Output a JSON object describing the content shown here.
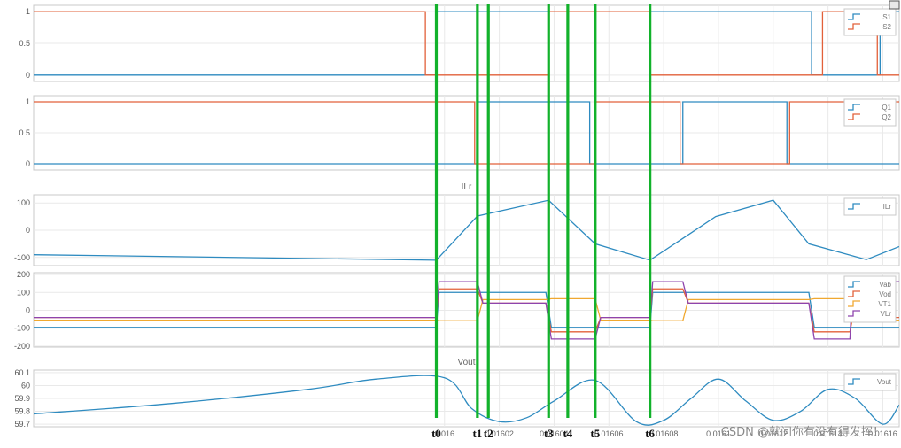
{
  "chart_data": [
    {
      "type": "line",
      "title": "",
      "ylim": [
        -0.1,
        1.1
      ],
      "yticks": [
        0,
        0.5,
        1
      ],
      "ytick_labels": [
        "0",
        "0.5",
        "1"
      ],
      "legend_location": "top-right",
      "series": [
        {
          "name": "S1",
          "color": "#2e8bc0",
          "x": [
            0.01585,
            0.015997,
            0.015997,
            0.016134,
            0.016134,
            0.016159,
            0.016159,
            0.016166
          ],
          "y": [
            0,
            0,
            1,
            1,
            0,
            0,
            1,
            1
          ]
        },
        {
          "name": "S2",
          "color": "#e2603a",
          "x": [
            0.01585,
            0.015993,
            0.015993,
            0.016038,
            0.016038,
            0.016075,
            0.016075,
            0.016138,
            0.016138,
            0.016158,
            0.016158,
            0.016166
          ],
          "y": [
            1,
            1,
            0,
            0,
            1,
            1,
            0,
            0,
            1,
            1,
            0,
            0
          ]
        }
      ]
    },
    {
      "type": "line",
      "title": "",
      "ylim": [
        -0.1,
        1.1
      ],
      "yticks": [
        0,
        0.5,
        1
      ],
      "ytick_labels": [
        "0",
        "0.5",
        "1"
      ],
      "legend_location": "top-right",
      "series": [
        {
          "name": "Q1",
          "color": "#2e8bc0",
          "x": [
            0.01585,
            0.016012,
            0.016012,
            0.016053,
            0.016053,
            0.016087,
            0.016087,
            0.016125,
            0.016125,
            0.016166
          ],
          "y": [
            0,
            0,
            1,
            1,
            0,
            0,
            1,
            1,
            0,
            0
          ]
        },
        {
          "name": "Q2",
          "color": "#e2603a",
          "x": [
            0.01585,
            0.016011,
            0.016011,
            0.016055,
            0.016055,
            0.016086,
            0.016086,
            0.016126,
            0.016126,
            0.016166
          ],
          "y": [
            1,
            1,
            0,
            0,
            1,
            1,
            0,
            0,
            1,
            1
          ]
        }
      ]
    },
    {
      "type": "line",
      "title": "ILr",
      "ylim": [
        -130,
        130
      ],
      "yticks": [
        -100,
        0,
        100
      ],
      "ytick_labels": [
        "-100",
        "0",
        "100"
      ],
      "legend_location": "top-right",
      "series": [
        {
          "name": "ILr",
          "color": "#2e8bc0",
          "x": [
            0.01585,
            0.015997,
            0.016012,
            0.016038,
            0.016055,
            0.016075,
            0.016099,
            0.01612,
            0.016133,
            0.016154,
            0.016166
          ],
          "y": [
            -90,
            -110,
            52,
            110,
            -50,
            -110,
            50,
            110,
            -50,
            -108,
            -60
          ]
        }
      ]
    },
    {
      "type": "line",
      "title": "",
      "ylim": [
        -205,
        210
      ],
      "yticks": [
        -200,
        -100,
        0,
        100,
        200
      ],
      "ytick_labels": [
        "-200",
        "-100",
        "0",
        "100",
        "200"
      ],
      "legend_location": "top-right",
      "series": [
        {
          "name": "Vab",
          "color": "#2e8bc0",
          "x": [
            0.01585,
            0.015997,
            0.015998,
            0.016037,
            0.016039,
            0.016075,
            0.016076,
            0.016133,
            0.016135,
            0.016166
          ],
          "y": [
            -95,
            -95,
            100,
            100,
            -95,
            -95,
            100,
            100,
            -95,
            -95
          ]
        },
        {
          "name": "Vod",
          "color": "#e2603a",
          "x": [
            0.01585,
            0.015997,
            0.015998,
            0.016012,
            0.016014,
            0.016037,
            0.016039,
            0.016055,
            0.016057,
            0.016075,
            0.016076,
            0.016087,
            0.016089,
            0.016133,
            0.016135,
            0.016148,
            0.016149,
            0.016166
          ],
          "y": [
            -40,
            -40,
            120,
            120,
            40,
            40,
            -120,
            -120,
            -40,
            -40,
            120,
            120,
            40,
            40,
            -120,
            -120,
            -40,
            -40
          ]
        },
        {
          "name": "VT1",
          "color": "#f0a830",
          "x": [
            0.01585,
            0.015997,
            0.015998,
            0.016012,
            0.016014,
            0.016037,
            0.016039,
            0.016055,
            0.016057,
            0.016075,
            0.016076,
            0.016087,
            0.016089,
            0.016133,
            0.016135,
            0.016148,
            0.016149,
            0.016166
          ],
          "y": [
            -55,
            -55,
            -58,
            -58,
            60,
            60,
            65,
            65,
            -55,
            -55,
            -58,
            -58,
            60,
            60,
            65,
            65,
            -55,
            -55
          ]
        },
        {
          "name": "VLr",
          "color": "#8e44ad",
          "x": [
            0.01585,
            0.015997,
            0.015998,
            0.016012,
            0.016014,
            0.016037,
            0.016039,
            0.016055,
            0.016057,
            0.016075,
            0.016076,
            0.016087,
            0.016089,
            0.016133,
            0.016135,
            0.016148,
            0.016149,
            0.016166
          ],
          "y": [
            -40,
            -40,
            160,
            160,
            40,
            40,
            -160,
            -160,
            -40,
            -40,
            160,
            160,
            40,
            40,
            -160,
            -160,
            160,
            160
          ]
        }
      ]
    },
    {
      "type": "line",
      "title": "Vout",
      "ylim": [
        59.68,
        60.12
      ],
      "yticks": [
        59.7,
        59.8,
        59.9,
        60,
        60.1
      ],
      "ytick_labels": [
        "59.7",
        "59.8",
        "59.9",
        "60",
        "60.1"
      ],
      "legend_location": "top-right",
      "xlim": [
        0.01585,
        0.016166
      ],
      "xticks": [
        0.016,
        0.01602,
        0.01604,
        0.01606,
        0.01608,
        0.0161,
        0.01612,
        0.01614,
        0.01616
      ],
      "xtick_labels": [
        "0.016",
        "0.01602",
        "0.01604",
        "0.01606",
        "0.01608",
        "0.0161",
        "0.01612",
        "0.01614",
        "0.01616"
      ],
      "series": [
        {
          "name": "Vout",
          "color": "#2e8bc0",
          "x": [
            0.01585,
            0.0159,
            0.01595,
            0.015975,
            0.016,
            0.01601,
            0.01602,
            0.01603,
            0.01604,
            0.016055,
            0.01607,
            0.01608,
            0.01609,
            0.0161,
            0.01611,
            0.01612,
            0.01613,
            0.01614,
            0.01615,
            0.01616,
            0.016166
          ],
          "y": [
            59.78,
            59.86,
            59.97,
            60.05,
            60.06,
            59.82,
            59.72,
            59.75,
            59.88,
            60.04,
            59.72,
            59.73,
            59.9,
            60.05,
            59.88,
            59.73,
            59.8,
            59.97,
            59.9,
            59.7,
            59.85
          ]
        }
      ]
    }
  ],
  "markers": [
    {
      "label": "t0",
      "x": 0.015997
    },
    {
      "label": "t1",
      "x": 0.016012
    },
    {
      "label": "t2",
      "x": 0.016016
    },
    {
      "label": "t3",
      "x": 0.016038
    },
    {
      "label": "t4",
      "x": 0.016045
    },
    {
      "label": "t5",
      "x": 0.016055
    },
    {
      "label": "t6",
      "x": 0.016075
    }
  ],
  "watermark": "CSDN @就问你有没有得发挥！"
}
